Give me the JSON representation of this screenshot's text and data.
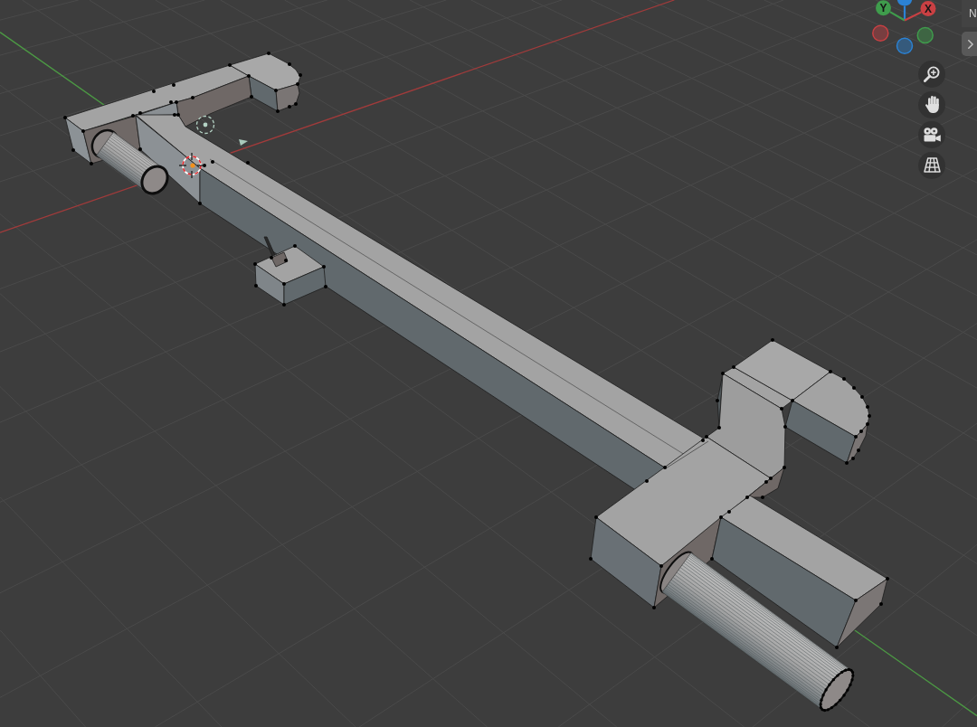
{
  "viewport": {
    "navigation_gizmo": {
      "axes": [
        {
          "kind": "positive",
          "color": "#2b82d4"
        },
        {
          "kind": "positive",
          "label": "Y",
          "color": "#3f9c4c"
        },
        {
          "kind": "positive",
          "label": "X",
          "color": "#c94043"
        },
        {
          "kind": "negative",
          "color": "#c94043"
        },
        {
          "kind": "negative",
          "color": "#3f9c4c"
        },
        {
          "kind": "negative",
          "color": "#2b82d4"
        }
      ]
    },
    "view_buttons": [
      {
        "kind": "zoom"
      },
      {
        "kind": "pan"
      },
      {
        "kind": "camera"
      },
      {
        "kind": "perspective"
      }
    ]
  },
  "sidebar": {
    "tab_label": "N"
  }
}
